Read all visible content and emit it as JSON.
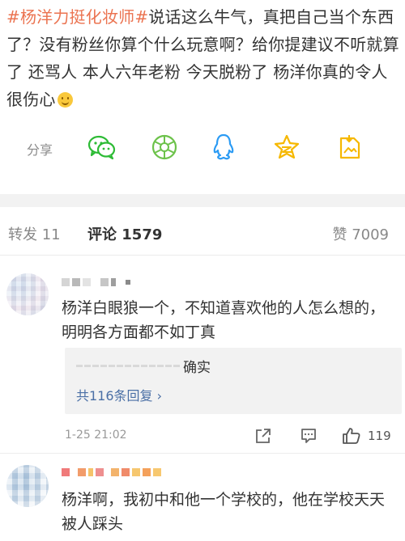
{
  "post": {
    "hashtag": "#杨洋力挺化妆师#",
    "body": "说话这么牛气，真把自己当个东西了？没有粉丝你算个什么玩意啊？给你提建议不听就算了 还骂人 本人六年老粉  今天脱粉了 杨洋你真的令人很伤心",
    "emoji_icon": "smile-emoji-icon"
  },
  "share": {
    "label": "分享",
    "targets": [
      {
        "name": "wechat-icon",
        "color": "#2dbb35"
      },
      {
        "name": "moments-icon",
        "color": "#6cc24a"
      },
      {
        "name": "qq-icon",
        "color": "#2b9bf4"
      },
      {
        "name": "qzone-icon",
        "color": "#f6b800"
      },
      {
        "name": "save-image-icon",
        "color": "#f6b800"
      }
    ]
  },
  "tabs": {
    "forward": "转发 11",
    "comments": "评论 1579",
    "likes": "赞 7009"
  },
  "comments": [
    {
      "text": "杨洋白眼狼一个，不知道喜欢他的人怎么想的，明明各方面都不如丁真",
      "reply": {
        "text": "确实",
        "more": "共116条回复 ›"
      },
      "timestamp": "1-25 21:02",
      "likes": "119"
    },
    {
      "text": "杨洋啊，我初中和他一个学校的，他在学校天天被人踩头"
    }
  ],
  "colors": {
    "hashtag": "#eb7350",
    "link": "#4a6fa5",
    "muted": "#888888"
  }
}
